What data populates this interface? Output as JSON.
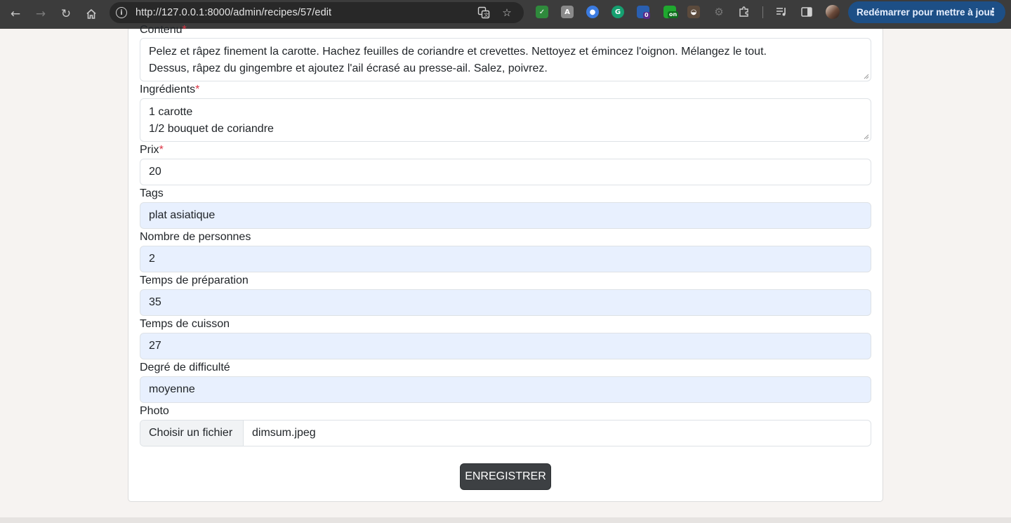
{
  "browser": {
    "url": "http://127.0.0.1:8000/admin/recipes/57/edit",
    "update_button": "Redémarrer pour mettre à jour",
    "extensions": [
      "mail-check-icon",
      "font-extension-icon",
      "circle-extension-icon",
      "grammarly-icon",
      "badge-0-extension-icon",
      "on-extension-icon",
      "bread-extension-icon",
      "gear-extension-icon",
      "puzzle-icon"
    ],
    "extension_badges": {
      "counter": "0",
      "on": "on"
    }
  },
  "form": {
    "contenu": {
      "label": "Contenu",
      "required_mark": "*",
      "lines": [
        "Pelez et râpez finement la carotte. Hachez feuilles de coriandre et crevettes. Nettoyez et émincez l'oignon. Mélangez le tout.",
        "Dessus, râpez du gingembre et ajoutez l'ail écrasé au presse-ail. Salez, poivrez."
      ]
    },
    "ingredients": {
      "label": "Ingrédients",
      "required_mark": "*",
      "lines": [
        "1 carotte",
        "1/2 bouquet de coriandre"
      ]
    },
    "prix": {
      "label": "Prix",
      "required_mark": "*",
      "value": "20"
    },
    "tags": {
      "label": "Tags",
      "value": "plat asiatique"
    },
    "personnes": {
      "label": "Nombre de personnes",
      "value": "2"
    },
    "preparation": {
      "label": "Temps de préparation",
      "value": "35"
    },
    "cuisson": {
      "label": "Temps de cuisson",
      "value": "27"
    },
    "difficulte": {
      "label": "Degré de difficulté",
      "value": "moyenne"
    },
    "photo": {
      "label": "Photo",
      "button": "Choisir un fichier",
      "filename": "dimsum.jpeg"
    },
    "submit": "ENREGISTRER"
  },
  "colors": {
    "required": "#dc3545",
    "autofill": "#e8f0fe",
    "submit_bg": "#3d4043",
    "update_btn": "#1d4f86"
  }
}
